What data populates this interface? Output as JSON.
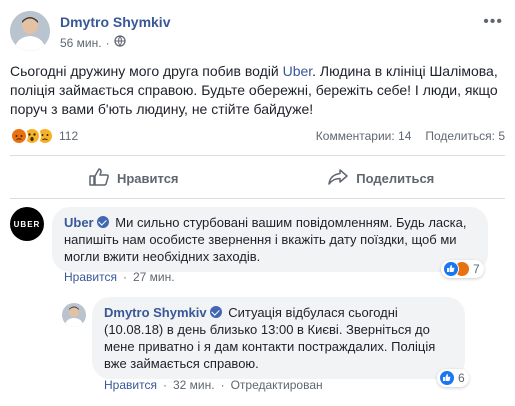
{
  "post": {
    "author": "Dmytro Shymkiv",
    "time": "56 мин.",
    "text_before_link": "Сьогодні дружину мого друга побив водій ",
    "link_text": "Uber",
    "text_after_link": ". Людина в клініці Шалімова, поліція займається справою. Будьте обережні, бережіть себе! І люди, якщо поруч з вами б'ють людину, не стійте байдуже!",
    "reaction_count": "112",
    "comments_stat": "Комментарии: 14",
    "shares_stat": "Поделиться: 5",
    "like_label": "Нравится",
    "share_label": "Поделиться"
  },
  "comments": [
    {
      "author": "Uber",
      "avatar_text": "UBER",
      "text": "Ми сильно стурбовані вашим повідомленням. Будь ласка, напишіть нам особисте звернення і вкажіть дату поїздки, щоб ми могли вжити необхідних заходів.",
      "like_label": "Нравится",
      "time": "27 мин.",
      "reaction_count": "7"
    },
    {
      "author": "Dmytro Shymkiv",
      "text": "Ситуація відбулася сьогодні (10.08.18) в день близько 13:00 в Києві. Зверніться до мене приватно і я дам контакти постраждалих. Поліція вже займається справою.",
      "like_label": "Нравится",
      "time": "32 мин.",
      "edited": "Отредактирован",
      "reaction_count": "6"
    }
  ],
  "colors": {
    "link": "#385898",
    "like_reaction": "#1877f2",
    "angry_reaction": "#e9710f",
    "wow_reaction": "#f7b125",
    "verified": "#4267b2"
  },
  "icons": [
    "more-options-icon",
    "globe-icon",
    "like-thumb-icon",
    "share-arrow-icon",
    "verified-badge-icon"
  ]
}
